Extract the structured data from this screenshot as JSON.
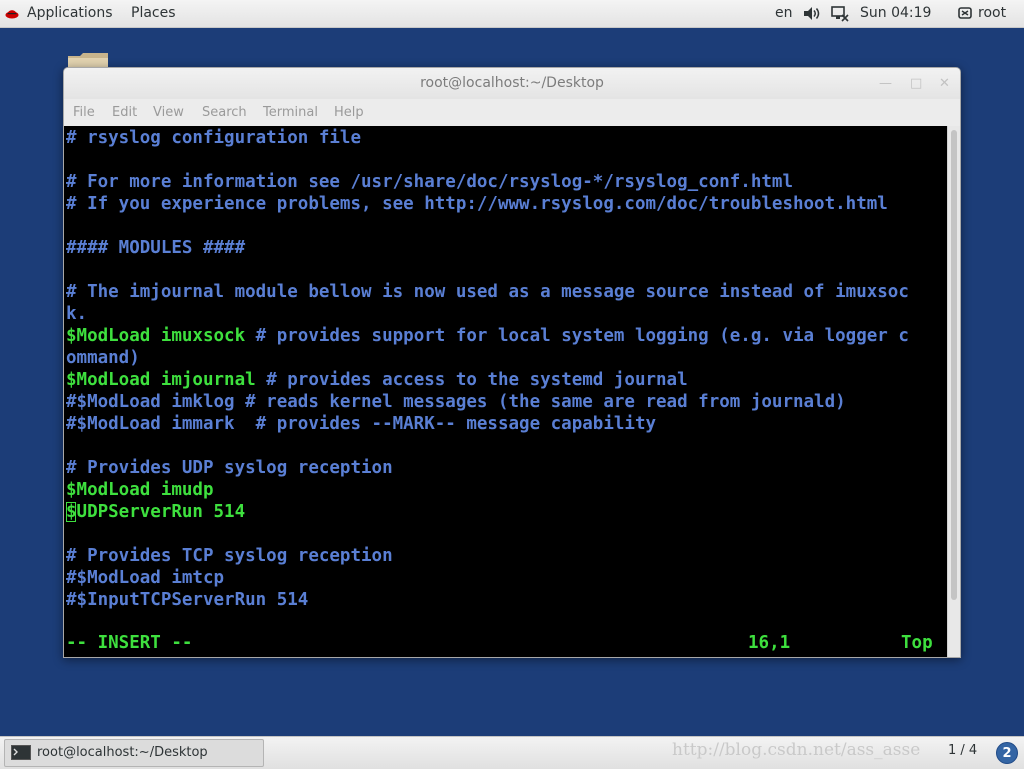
{
  "topbar": {
    "applications": "Applications",
    "places": "Places",
    "language": "en",
    "clock": "Sun 04:19",
    "user": "root"
  },
  "window": {
    "title": "root@localhost:~/Desktop",
    "menu": [
      "File",
      "Edit",
      "View",
      "Search",
      "Terminal",
      "Help"
    ]
  },
  "terminal": {
    "lines": [
      "# rsyslog configuration file",
      "",
      "# For more information see /usr/share/doc/rsyslog-*/rsyslog_conf.html",
      "# If you experience problems, see http://www.rsyslog.com/doc/troubleshoot.html",
      "",
      "#### MODULES ####",
      "",
      "# The imjournal module bellow is now used as a message source instead of imuxsoc",
      "k.",
      "$ModLoad imuxsock",
      " # provides support for local system logging (e.g. via logger c",
      "ommand)",
      "$ModLoad imjournal",
      " # provides access to the systemd journal",
      "#$ModLoad imklog # reads kernel messages (the same are read from journald)",
      "#$ModLoad immark  # provides --MARK-- message capability",
      "",
      "# Provides UDP syslog reception",
      "$ModLoad imudp",
      "$UDPServerRun 514",
      "",
      "# Provides TCP syslog reception",
      "#$ModLoad imtcp",
      "#$InputTCPServerRun 514"
    ],
    "mode": "-- INSERT --",
    "position": "16,1",
    "scroll": "Top"
  },
  "taskbar": {
    "task_label": "root@localhost:~/Desktop",
    "watermark": "http://blog.csdn.net/ass_asse",
    "workspace": "1 / 4",
    "notifications": "2"
  },
  "colors": {
    "desktop": "#1c3d78",
    "comment": "#5a7fd4",
    "directive": "#3ee03e"
  }
}
